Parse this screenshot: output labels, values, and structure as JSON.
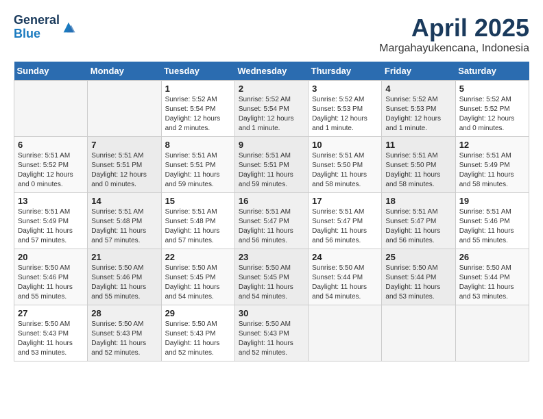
{
  "header": {
    "logo_general": "General",
    "logo_blue": "Blue",
    "month": "April 2025",
    "location": "Margahayukencana, Indonesia"
  },
  "weekdays": [
    "Sunday",
    "Monday",
    "Tuesday",
    "Wednesday",
    "Thursday",
    "Friday",
    "Saturday"
  ],
  "weeks": [
    [
      {
        "day": "",
        "info": ""
      },
      {
        "day": "",
        "info": ""
      },
      {
        "day": "1",
        "info": "Sunrise: 5:52 AM\nSunset: 5:54 PM\nDaylight: 12 hours and 2 minutes."
      },
      {
        "day": "2",
        "info": "Sunrise: 5:52 AM\nSunset: 5:54 PM\nDaylight: 12 hours and 1 minute."
      },
      {
        "day": "3",
        "info": "Sunrise: 5:52 AM\nSunset: 5:53 PM\nDaylight: 12 hours and 1 minute."
      },
      {
        "day": "4",
        "info": "Sunrise: 5:52 AM\nSunset: 5:53 PM\nDaylight: 12 hours and 1 minute."
      },
      {
        "day": "5",
        "info": "Sunrise: 5:52 AM\nSunset: 5:52 PM\nDaylight: 12 hours and 0 minutes."
      }
    ],
    [
      {
        "day": "6",
        "info": "Sunrise: 5:51 AM\nSunset: 5:52 PM\nDaylight: 12 hours and 0 minutes."
      },
      {
        "day": "7",
        "info": "Sunrise: 5:51 AM\nSunset: 5:51 PM\nDaylight: 12 hours and 0 minutes."
      },
      {
        "day": "8",
        "info": "Sunrise: 5:51 AM\nSunset: 5:51 PM\nDaylight: 11 hours and 59 minutes."
      },
      {
        "day": "9",
        "info": "Sunrise: 5:51 AM\nSunset: 5:51 PM\nDaylight: 11 hours and 59 minutes."
      },
      {
        "day": "10",
        "info": "Sunrise: 5:51 AM\nSunset: 5:50 PM\nDaylight: 11 hours and 58 minutes."
      },
      {
        "day": "11",
        "info": "Sunrise: 5:51 AM\nSunset: 5:50 PM\nDaylight: 11 hours and 58 minutes."
      },
      {
        "day": "12",
        "info": "Sunrise: 5:51 AM\nSunset: 5:49 PM\nDaylight: 11 hours and 58 minutes."
      }
    ],
    [
      {
        "day": "13",
        "info": "Sunrise: 5:51 AM\nSunset: 5:49 PM\nDaylight: 11 hours and 57 minutes."
      },
      {
        "day": "14",
        "info": "Sunrise: 5:51 AM\nSunset: 5:48 PM\nDaylight: 11 hours and 57 minutes."
      },
      {
        "day": "15",
        "info": "Sunrise: 5:51 AM\nSunset: 5:48 PM\nDaylight: 11 hours and 57 minutes."
      },
      {
        "day": "16",
        "info": "Sunrise: 5:51 AM\nSunset: 5:47 PM\nDaylight: 11 hours and 56 minutes."
      },
      {
        "day": "17",
        "info": "Sunrise: 5:51 AM\nSunset: 5:47 PM\nDaylight: 11 hours and 56 minutes."
      },
      {
        "day": "18",
        "info": "Sunrise: 5:51 AM\nSunset: 5:47 PM\nDaylight: 11 hours and 56 minutes."
      },
      {
        "day": "19",
        "info": "Sunrise: 5:51 AM\nSunset: 5:46 PM\nDaylight: 11 hours and 55 minutes."
      }
    ],
    [
      {
        "day": "20",
        "info": "Sunrise: 5:50 AM\nSunset: 5:46 PM\nDaylight: 11 hours and 55 minutes."
      },
      {
        "day": "21",
        "info": "Sunrise: 5:50 AM\nSunset: 5:46 PM\nDaylight: 11 hours and 55 minutes."
      },
      {
        "day": "22",
        "info": "Sunrise: 5:50 AM\nSunset: 5:45 PM\nDaylight: 11 hours and 54 minutes."
      },
      {
        "day": "23",
        "info": "Sunrise: 5:50 AM\nSunset: 5:45 PM\nDaylight: 11 hours and 54 minutes."
      },
      {
        "day": "24",
        "info": "Sunrise: 5:50 AM\nSunset: 5:44 PM\nDaylight: 11 hours and 54 minutes."
      },
      {
        "day": "25",
        "info": "Sunrise: 5:50 AM\nSunset: 5:44 PM\nDaylight: 11 hours and 53 minutes."
      },
      {
        "day": "26",
        "info": "Sunrise: 5:50 AM\nSunset: 5:44 PM\nDaylight: 11 hours and 53 minutes."
      }
    ],
    [
      {
        "day": "27",
        "info": "Sunrise: 5:50 AM\nSunset: 5:43 PM\nDaylight: 11 hours and 53 minutes."
      },
      {
        "day": "28",
        "info": "Sunrise: 5:50 AM\nSunset: 5:43 PM\nDaylight: 11 hours and 52 minutes."
      },
      {
        "day": "29",
        "info": "Sunrise: 5:50 AM\nSunset: 5:43 PM\nDaylight: 11 hours and 52 minutes."
      },
      {
        "day": "30",
        "info": "Sunrise: 5:50 AM\nSunset: 5:43 PM\nDaylight: 11 hours and 52 minutes."
      },
      {
        "day": "",
        "info": ""
      },
      {
        "day": "",
        "info": ""
      },
      {
        "day": "",
        "info": ""
      }
    ]
  ]
}
